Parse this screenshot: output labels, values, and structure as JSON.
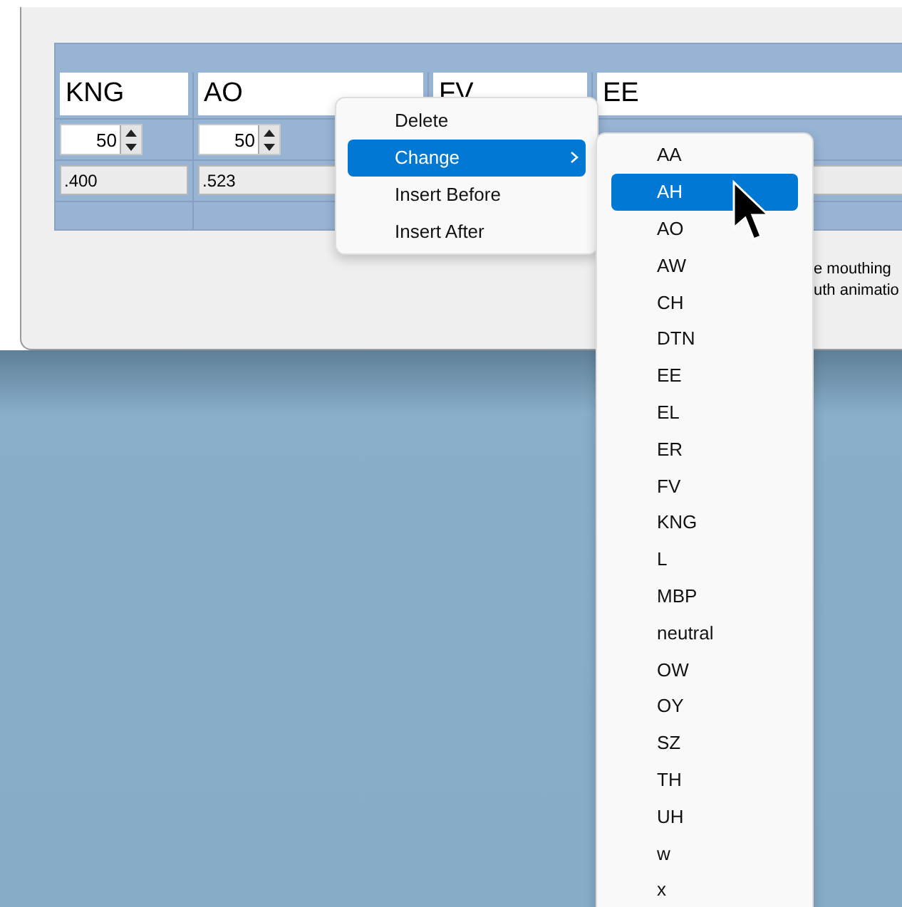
{
  "table": {
    "columns": [
      {
        "name": "KNG",
        "spinner": "50",
        "value": ".400"
      },
      {
        "name": "AO",
        "spinner": "50",
        "value": ".523"
      },
      {
        "name": "FV"
      },
      {
        "name": "EE",
        "value_field": true
      }
    ]
  },
  "note_lines": [
    "e mouthing",
    "uth animatio"
  ],
  "context_menu": {
    "items": [
      {
        "label": "Delete",
        "selected": false,
        "submenu": false
      },
      {
        "label": "Change",
        "selected": true,
        "submenu": true
      },
      {
        "label": "Insert Before",
        "selected": false,
        "submenu": false
      },
      {
        "label": "Insert After",
        "selected": false,
        "submenu": false
      }
    ]
  },
  "submenu": {
    "items": [
      {
        "label": "AA",
        "selected": false
      },
      {
        "label": "AH",
        "selected": true
      },
      {
        "label": "AO",
        "selected": false
      },
      {
        "label": "AW",
        "selected": false
      },
      {
        "label": "CH",
        "selected": false
      },
      {
        "label": "DTN",
        "selected": false
      },
      {
        "label": "EE",
        "selected": false
      },
      {
        "label": "EL",
        "selected": false
      },
      {
        "label": "ER",
        "selected": false
      },
      {
        "label": "FV",
        "selected": false
      },
      {
        "label": "KNG",
        "selected": false
      },
      {
        "label": "L",
        "selected": false
      },
      {
        "label": "MBP",
        "selected": false
      },
      {
        "label": "neutral",
        "selected": false
      },
      {
        "label": "OW",
        "selected": false
      },
      {
        "label": "OY",
        "selected": false
      },
      {
        "label": "SZ",
        "selected": false
      },
      {
        "label": "TH",
        "selected": false
      },
      {
        "label": "UH",
        "selected": false
      },
      {
        "label": "w",
        "selected": false
      },
      {
        "label": "x",
        "selected": false
      }
    ]
  }
}
